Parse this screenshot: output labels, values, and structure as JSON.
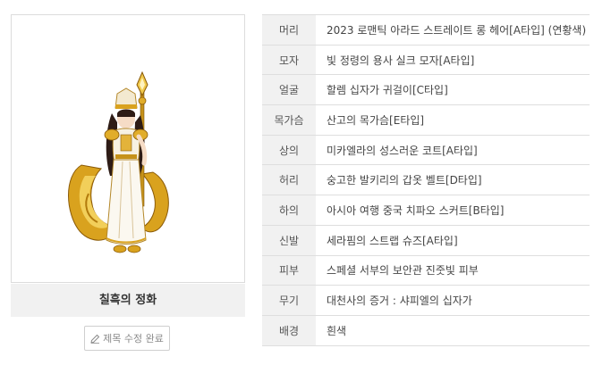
{
  "character": {
    "name": "칠흑의 정화",
    "edit_button_label": "제목 수정 완료",
    "edit_icon": "pencil-icon"
  },
  "equipment": [
    {
      "slot": "머리",
      "item": "2023 로맨틱 아라드 스트레이트 롱 헤어[A타입] (연황색)"
    },
    {
      "slot": "모자",
      "item": "빛 정령의 용사 실크 모자[A타입]"
    },
    {
      "slot": "얼굴",
      "item": "할렘 십자가 귀걸이[C타입]"
    },
    {
      "slot": "목가슴",
      "item": "산고의 목가슴[E타입]"
    },
    {
      "slot": "상의",
      "item": "미카엘라의 성스러운 코트[A타입]"
    },
    {
      "slot": "허리",
      "item": "숭고한 발키리의 갑옷 벨트[D타입]"
    },
    {
      "slot": "하의",
      "item": "아시아 여행 중국 치파오 스커트[B타입]"
    },
    {
      "slot": "신발",
      "item": "세라핌의 스트랩 슈즈[A타입]"
    },
    {
      "slot": "피부",
      "item": "스페셜 서부의 보안관 진줏빛 피부"
    },
    {
      "slot": "무기",
      "item": "대천사의 증거 : 샤피엘의 십자가"
    },
    {
      "slot": "배경",
      "item": "흰색"
    }
  ]
}
